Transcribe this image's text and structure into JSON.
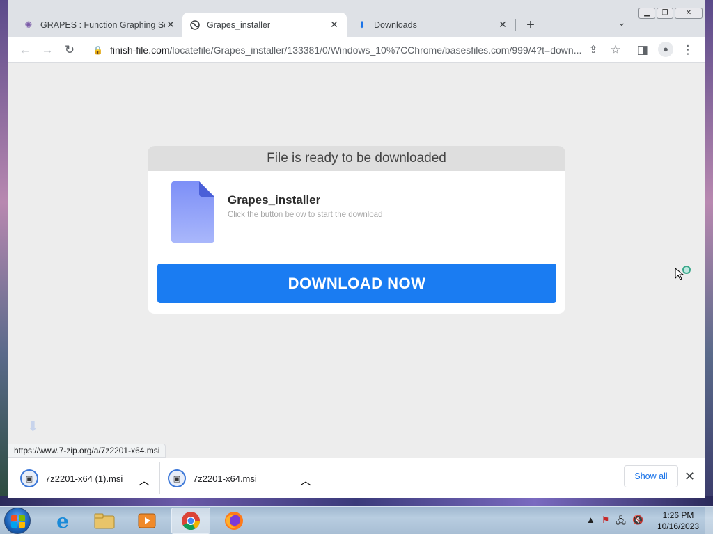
{
  "browser": {
    "tabs": [
      {
        "title": "GRAPES : Function Graphing Soft",
        "active": false,
        "icon": "grapes-icon"
      },
      {
        "title": "Grapes_installer",
        "active": true,
        "icon": "globe-icon"
      },
      {
        "title": "Downloads",
        "active": false,
        "icon": "download-icon"
      }
    ],
    "url_host": "finish-file.com",
    "url_path": "/locatefile/Grapes_installer/133381/0/Windows_10%7CChrome/basesfiles.com/999/4?t=down..."
  },
  "page": {
    "header": "File is ready to be downloaded",
    "file_name": "Grapes_installer",
    "hint": "Click the button below to start the download",
    "button_label": "DOWNLOAD NOW",
    "button_color": "#1a7cf2",
    "status_link": "https://www.7-zip.org/a/7z2201-x64.msi"
  },
  "downloads": {
    "items": [
      {
        "name": "7z2201-x64 (1).msi"
      },
      {
        "name": "7z2201-x64.msi"
      }
    ],
    "show_all": "Show all"
  },
  "taskbar": {
    "time": "1:26 PM",
    "date": "10/16/2023"
  }
}
